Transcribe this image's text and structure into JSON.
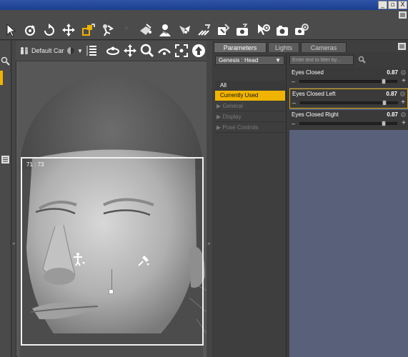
{
  "window": {
    "buttons": [
      "_",
      "▫",
      "X"
    ]
  },
  "toolbar": {
    "tools": [
      {
        "icon": "pointer-icon"
      },
      {
        "icon": "rotate-icon"
      },
      {
        "icon": "twist-icon"
      },
      {
        "icon": "move-icon"
      },
      {
        "icon": "scale-icon"
      },
      {
        "icon": "joint-editor-icon"
      },
      {
        "icon": "funnel-icon"
      },
      {
        "icon": "surface-selection-icon"
      },
      {
        "icon": "figure-icon"
      },
      {
        "icon": "geometry-editor-icon"
      },
      {
        "icon": "brush-icon"
      },
      {
        "icon": "node-weight-icon"
      },
      {
        "icon": "camera-icon"
      },
      {
        "icon": "render-settings-icon"
      },
      {
        "icon": "render-icon"
      },
      {
        "icon": "render-gear-icon"
      }
    ]
  },
  "viewport": {
    "camera_label": "Default Car",
    "aspect_readout": "71 : 73"
  },
  "panel": {
    "tabs": [
      "Parameters",
      "Lights",
      "Cameras"
    ],
    "active_tab": "Parameters",
    "node": "Genesis : Head",
    "groups": [
      {
        "label": "All",
        "state": "normal"
      },
      {
        "label": "Currently Used",
        "state": "selected"
      }
    ],
    "categories": [
      "General",
      "Display",
      "Pose Controls"
    ],
    "filter_placeholder": "Enter text to filter by...",
    "parameters": [
      {
        "name": "Eyes Closed",
        "value": "0.87",
        "fraction": 0.87,
        "selected": false
      },
      {
        "name": "Eyes Closed Left",
        "value": "0.87",
        "fraction": 0.87,
        "selected": true
      },
      {
        "name": "Eyes Closed Right",
        "value": "0.87",
        "fraction": 0.87,
        "selected": false
      }
    ]
  },
  "colors": {
    "accent": "#f0b400",
    "panel_bg": "#3c3c3c",
    "param_area": "#58607a"
  }
}
